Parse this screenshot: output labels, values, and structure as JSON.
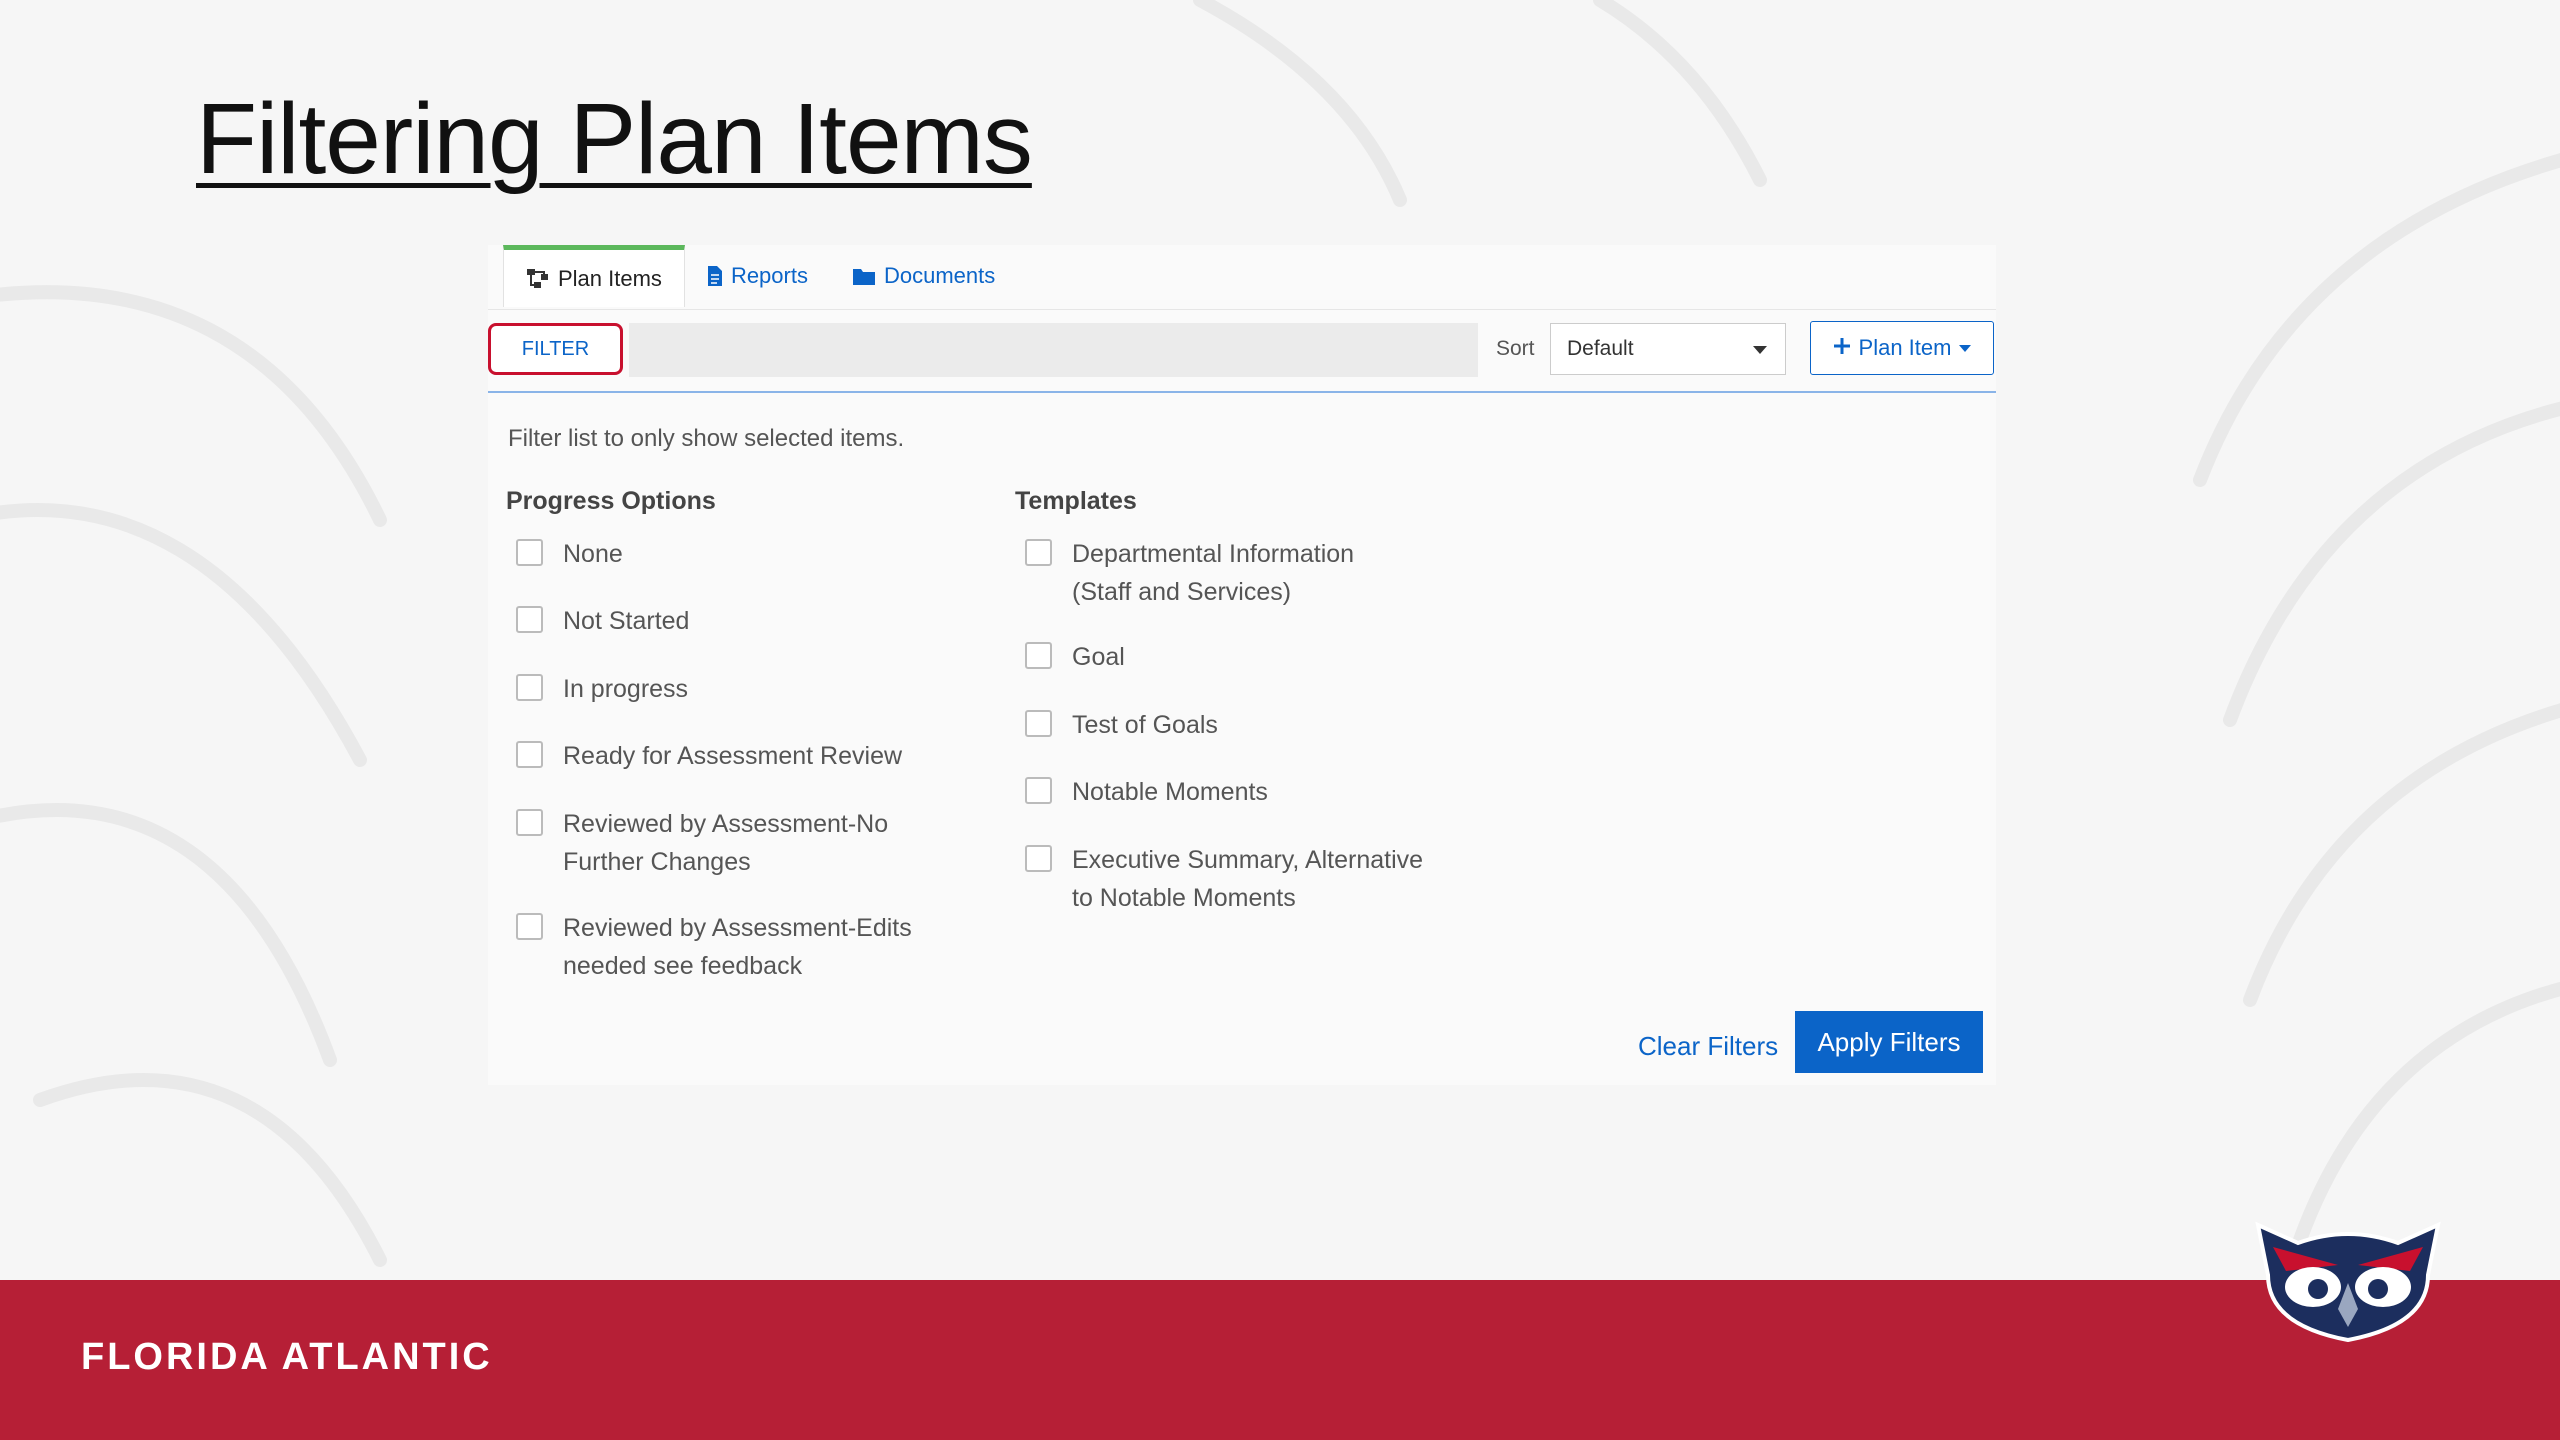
{
  "slide": {
    "title": "Filtering Plan Items"
  },
  "tabs": [
    {
      "label": "Plan Items",
      "icon": "hierarchy-icon",
      "active": true
    },
    {
      "label": "Reports",
      "icon": "document-icon",
      "active": false
    },
    {
      "label": "Documents",
      "icon": "folder-icon",
      "active": false
    }
  ],
  "toolbar": {
    "filter_label": "FILTER",
    "sort_label": "Sort",
    "sort_value": "Default",
    "add_label": "Plan Item"
  },
  "filter_panel": {
    "hint": "Filter list to only show selected items.",
    "progress": {
      "title": "Progress Options",
      "options": [
        "None",
        "Not Started",
        "In progress",
        "Ready for Assessment Review",
        "Reviewed by Assessment-No\nFurther Changes",
        "Reviewed by Assessment-Edits\nneeded see feedback"
      ]
    },
    "templates": {
      "title": "Templates",
      "options": [
        "Departmental Information\n(Staff and Services)",
        "Goal",
        "Test of Goals",
        "Notable Moments",
        "Executive Summary, Alternative\nto Notable Moments"
      ]
    },
    "clear_label": "Clear Filters",
    "apply_label": "Apply Filters"
  },
  "footer": {
    "brand": "FLORIDA ATLANTIC"
  },
  "colors": {
    "accent": "#0b64c8",
    "brand_red": "#b61f36",
    "active_tab": "#5cb85c",
    "highlight": "#c8102e"
  }
}
